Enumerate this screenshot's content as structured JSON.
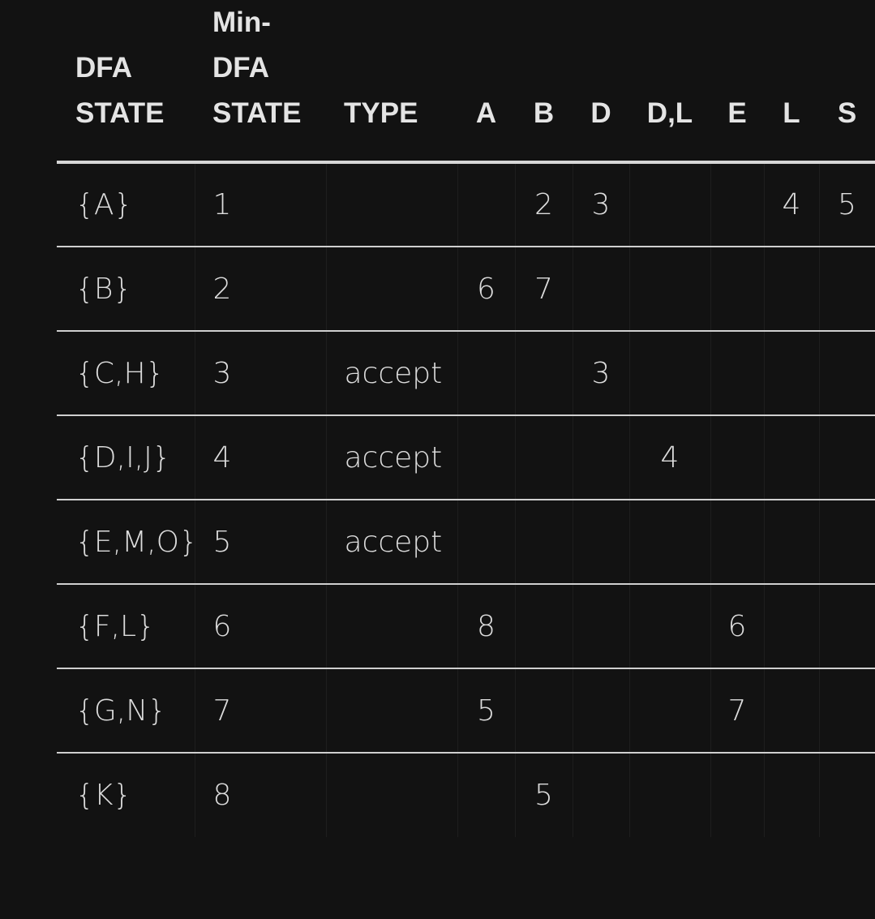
{
  "table": {
    "headers": {
      "dfa_state": [
        "DFA",
        "STATE"
      ],
      "min_dfa_state": [
        "Min-",
        "DFA",
        "STATE"
      ],
      "type": "TYPE",
      "letters": [
        "A",
        "B",
        "D",
        "D,L",
        "E",
        "L",
        "S"
      ]
    },
    "rows": [
      {
        "dfa": "{A}",
        "min": "1",
        "type": "",
        "cells": [
          "",
          "2",
          "3",
          "",
          "",
          "4",
          "5"
        ]
      },
      {
        "dfa": "{B}",
        "min": "2",
        "type": "",
        "cells": [
          "6",
          "7",
          "",
          "",
          "",
          "",
          ""
        ]
      },
      {
        "dfa": "{C,H}",
        "min": "3",
        "type": "accept",
        "cells": [
          "",
          "",
          "3",
          "",
          "",
          "",
          ""
        ]
      },
      {
        "dfa": "{D,I,J}",
        "min": "4",
        "type": "accept",
        "cells": [
          "",
          "",
          "",
          "4",
          "",
          "",
          ""
        ]
      },
      {
        "dfa": "{E,M,O}",
        "min": "5",
        "type": "accept",
        "cells": [
          "",
          "",
          "",
          "",
          "",
          "",
          ""
        ]
      },
      {
        "dfa": "{F,L}",
        "min": "6",
        "type": "",
        "cells": [
          "8",
          "",
          "",
          "",
          "6",
          "",
          ""
        ]
      },
      {
        "dfa": "{G,N}",
        "min": "7",
        "type": "",
        "cells": [
          "5",
          "",
          "",
          "",
          "7",
          "",
          ""
        ]
      },
      {
        "dfa": "{K}",
        "min": "8",
        "type": "",
        "cells": [
          "",
          "5",
          "",
          "",
          "",
          "",
          ""
        ]
      }
    ]
  },
  "colors": {
    "background": "#121212",
    "text": "#e6e6e6",
    "rule": "#d6d6d6"
  }
}
